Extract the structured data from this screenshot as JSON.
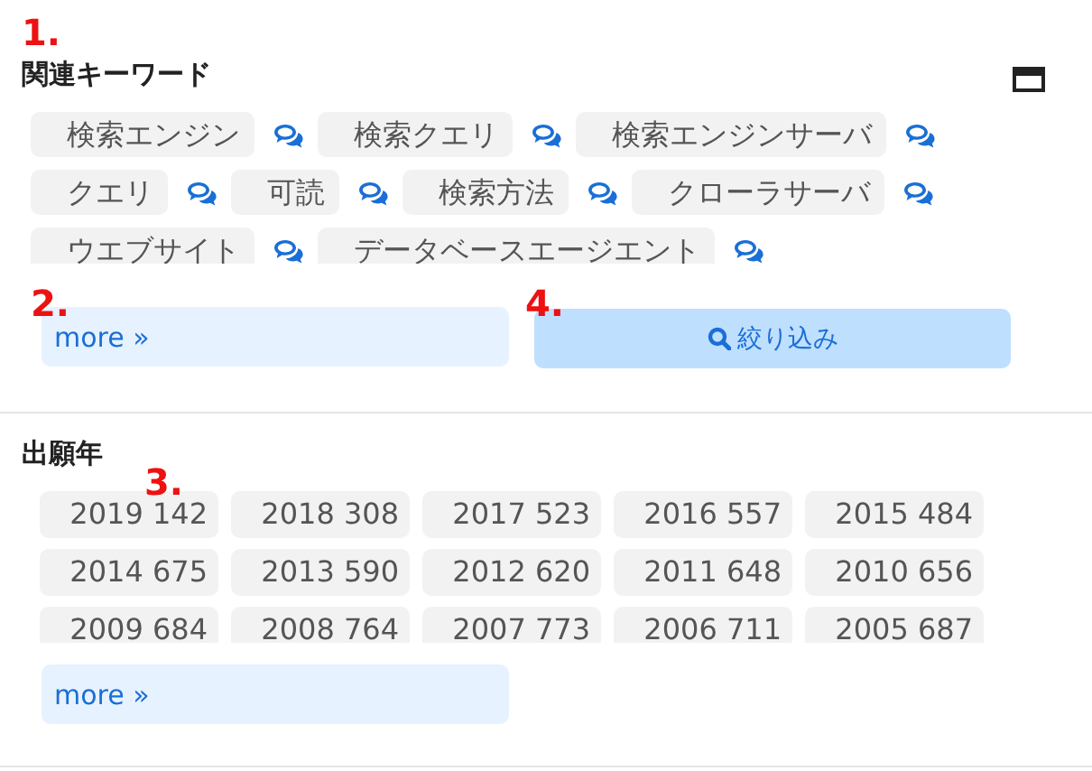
{
  "keywords_section": {
    "title": "関連キーワード",
    "tags": [
      {
        "label": "検索エンジン"
      },
      {
        "label": "検索クエリ"
      },
      {
        "label": "検索エンジンサーバ"
      },
      {
        "label": "クエリ"
      },
      {
        "label": "可読"
      },
      {
        "label": "検索方法"
      },
      {
        "label": "クローラサーバ"
      },
      {
        "label": "ウエブサイト"
      },
      {
        "label": "データベースエージエント"
      }
    ],
    "more_button": "more »",
    "filter_button": "絞り込み"
  },
  "year_section": {
    "title": "出願年",
    "tags": [
      "2019 142",
      "2018 308",
      "2017 523",
      "2016 557",
      "2015 484",
      "2014 675",
      "2013 590",
      "2012 620",
      "2011 648",
      "2010 656",
      "2009 684",
      "2008 764",
      "2007 773",
      "2006 711",
      "2005 687"
    ],
    "more_button": "more »"
  },
  "annotations": [
    "1.",
    "2.",
    "3.",
    "4."
  ]
}
